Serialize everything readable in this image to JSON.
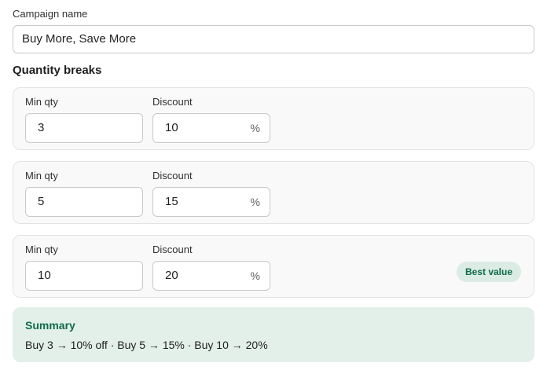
{
  "campaign": {
    "label": "Campaign name",
    "value": "Buy More, Save More"
  },
  "quantity_breaks": {
    "title": "Quantity breaks",
    "min_qty_label": "Min qty",
    "discount_label": "Discount",
    "percent_suffix": "%",
    "items": [
      {
        "min_qty": "3",
        "discount": "10",
        "badge": ""
      },
      {
        "min_qty": "5",
        "discount": "15",
        "badge": ""
      },
      {
        "min_qty": "10",
        "discount": "20",
        "badge": "Best value"
      }
    ]
  },
  "summary": {
    "title": "Summary",
    "text": "Buy 3 → 10% off  ·  Buy 5 → 15%  ·  Buy 10 → 20%"
  },
  "colors": {
    "accent": "#0f6b4c",
    "summary_bg": "#e3f0ea",
    "badge_bg": "#dbece4"
  }
}
